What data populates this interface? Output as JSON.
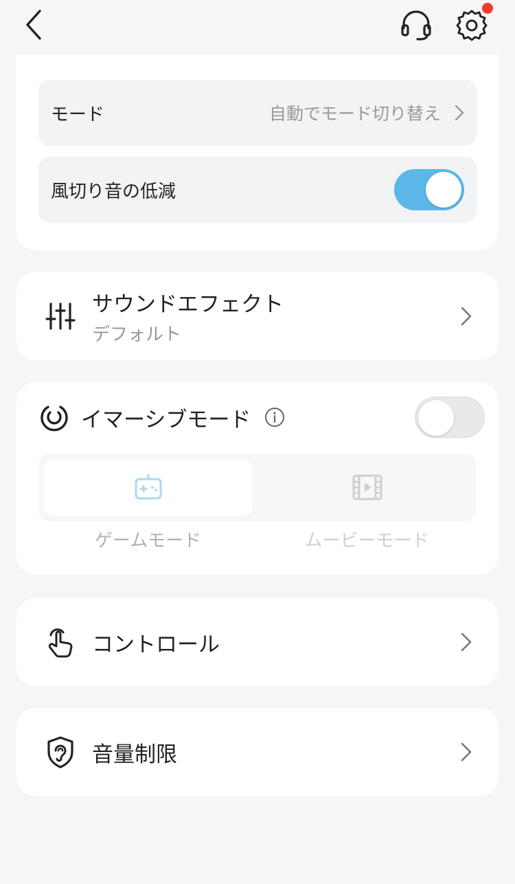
{
  "colors": {
    "accent": "#5bb7e7",
    "background": "#f5f6f8",
    "card": "#ffffff",
    "notification": "#ee3b2f"
  },
  "header": {
    "icons": [
      "chevron-left-icon",
      "headset-icon",
      "gear-icon"
    ],
    "has_notification": true
  },
  "mode_row": {
    "label": "モード",
    "value": "自動でモード切り替え"
  },
  "wind_row": {
    "label": "風切り音の低減",
    "toggle_on": true
  },
  "sound_effect": {
    "title": "サウンドエフェクト",
    "subtitle": "デフォルト",
    "icon": "equalizer-sliders-icon"
  },
  "immersive": {
    "title": "イマーシブモード",
    "toggle_on": false,
    "options": [
      {
        "label": "ゲームモード",
        "icon": "gamepad-icon",
        "selected": true
      },
      {
        "label": "ムービーモード",
        "icon": "film-icon",
        "selected": false
      }
    ]
  },
  "controls": {
    "title": "コントロール",
    "icon": "touch-finger-icon"
  },
  "volume_limit": {
    "title": "音量制限",
    "icon": "ear-shield-icon"
  }
}
